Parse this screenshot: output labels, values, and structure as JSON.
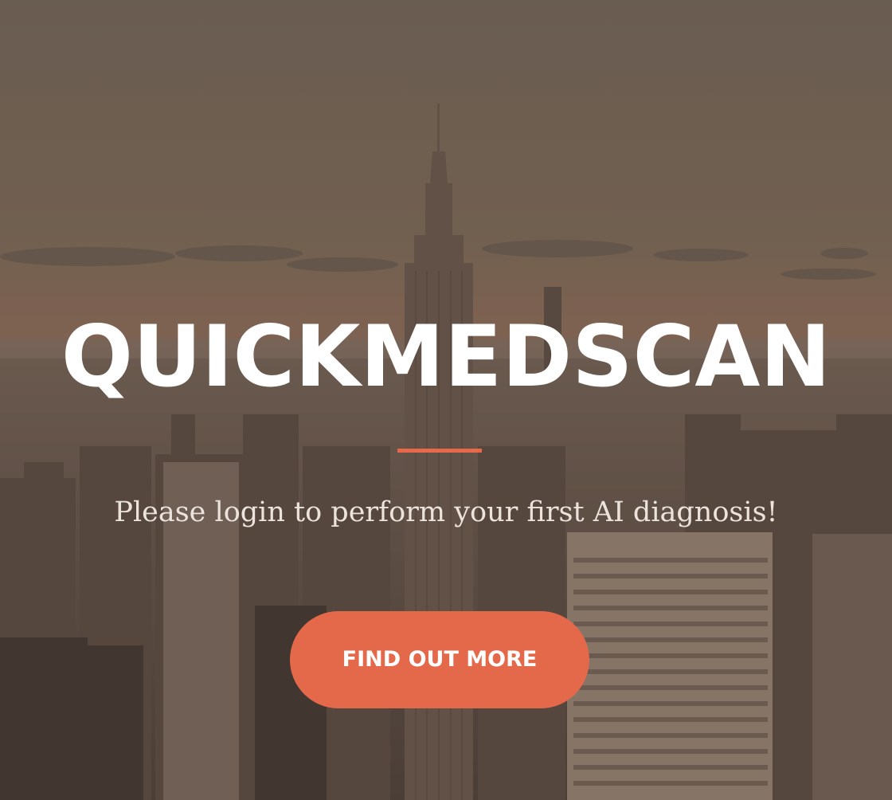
{
  "hero": {
    "title": "QUICKMEDSCAN",
    "subtitle": "Please login to perform your first AI diagnosis!",
    "cta_label": "FIND OUT MORE",
    "background": "city-skyline-photo"
  },
  "colors": {
    "accent": "#e4694a",
    "title_text": "#ffffff",
    "subtitle_text": "#ece4dc",
    "overlay": "#483a32"
  }
}
